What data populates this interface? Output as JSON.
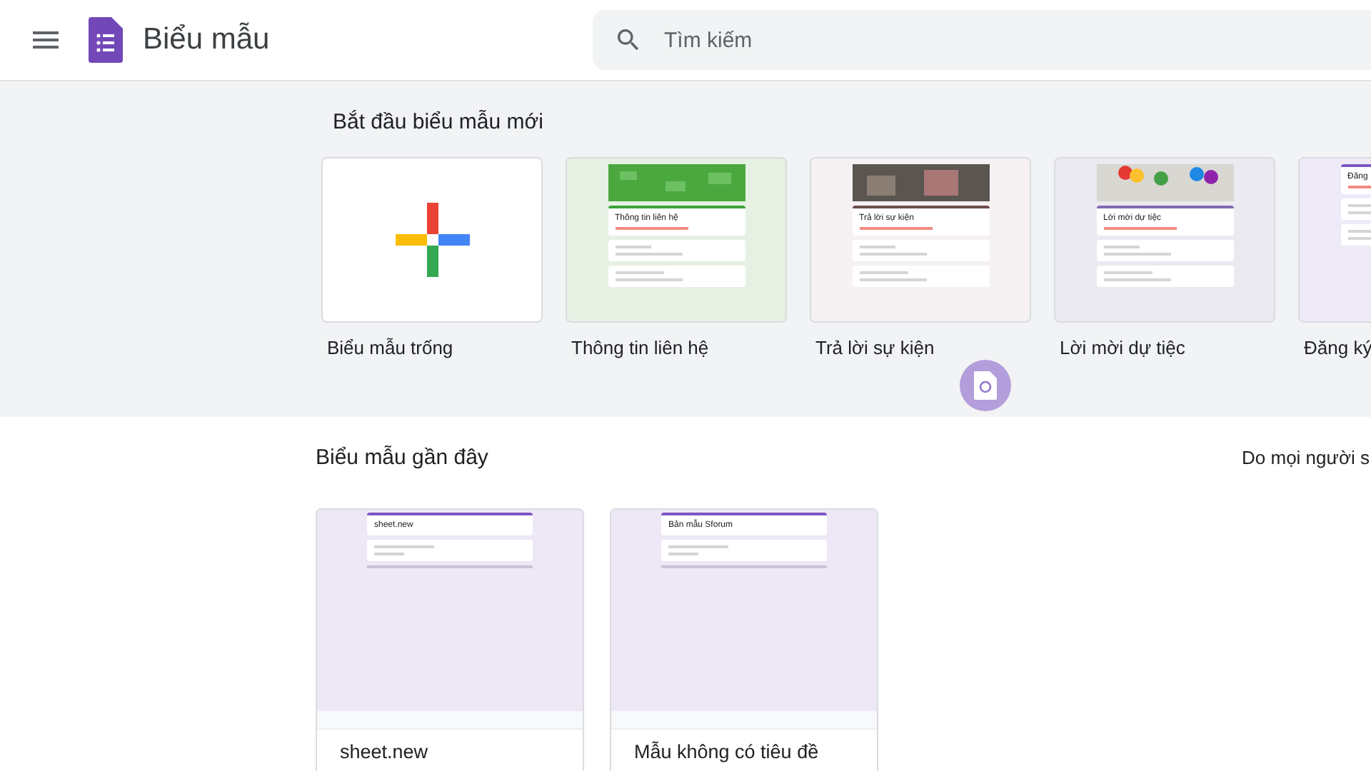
{
  "header": {
    "app_title": "Biểu mẫu",
    "search_placeholder": "Tìm kiếm"
  },
  "templates": {
    "title": "Bắt đầu biểu mẫu mới",
    "items": [
      {
        "label": "Biểu mẫu trống",
        "preview": {
          "kind": "blank"
        }
      },
      {
        "label": "Thông tin liên hệ",
        "preview": {
          "kind": "pattern",
          "color": "#e6f1e3",
          "title": "Thông tin liên hệ"
        }
      },
      {
        "label": "Trả lời sự kiện",
        "preview": {
          "kind": "photo",
          "color": "#f6f1f2",
          "title": "Trả lời sự kiện"
        }
      },
      {
        "label": "Lời mời dự tiệc",
        "preview": {
          "kind": "balloons",
          "color": "#ebeaf1",
          "title": "Lời mời dự tiệc"
        }
      },
      {
        "label": "Đăng ký",
        "preview": {
          "kind": "plain",
          "color": "#efeaf8",
          "title": "Đăng"
        }
      }
    ]
  },
  "recent": {
    "title": "Biểu mẫu gần đây",
    "owner_filter": "Do mọi người s",
    "items": [
      {
        "title": "sheet.new",
        "preview_title": "sheet.new"
      },
      {
        "title": "Mẫu không có tiêu đề",
        "preview_title": "Bản mẫu Sforum"
      }
    ]
  }
}
